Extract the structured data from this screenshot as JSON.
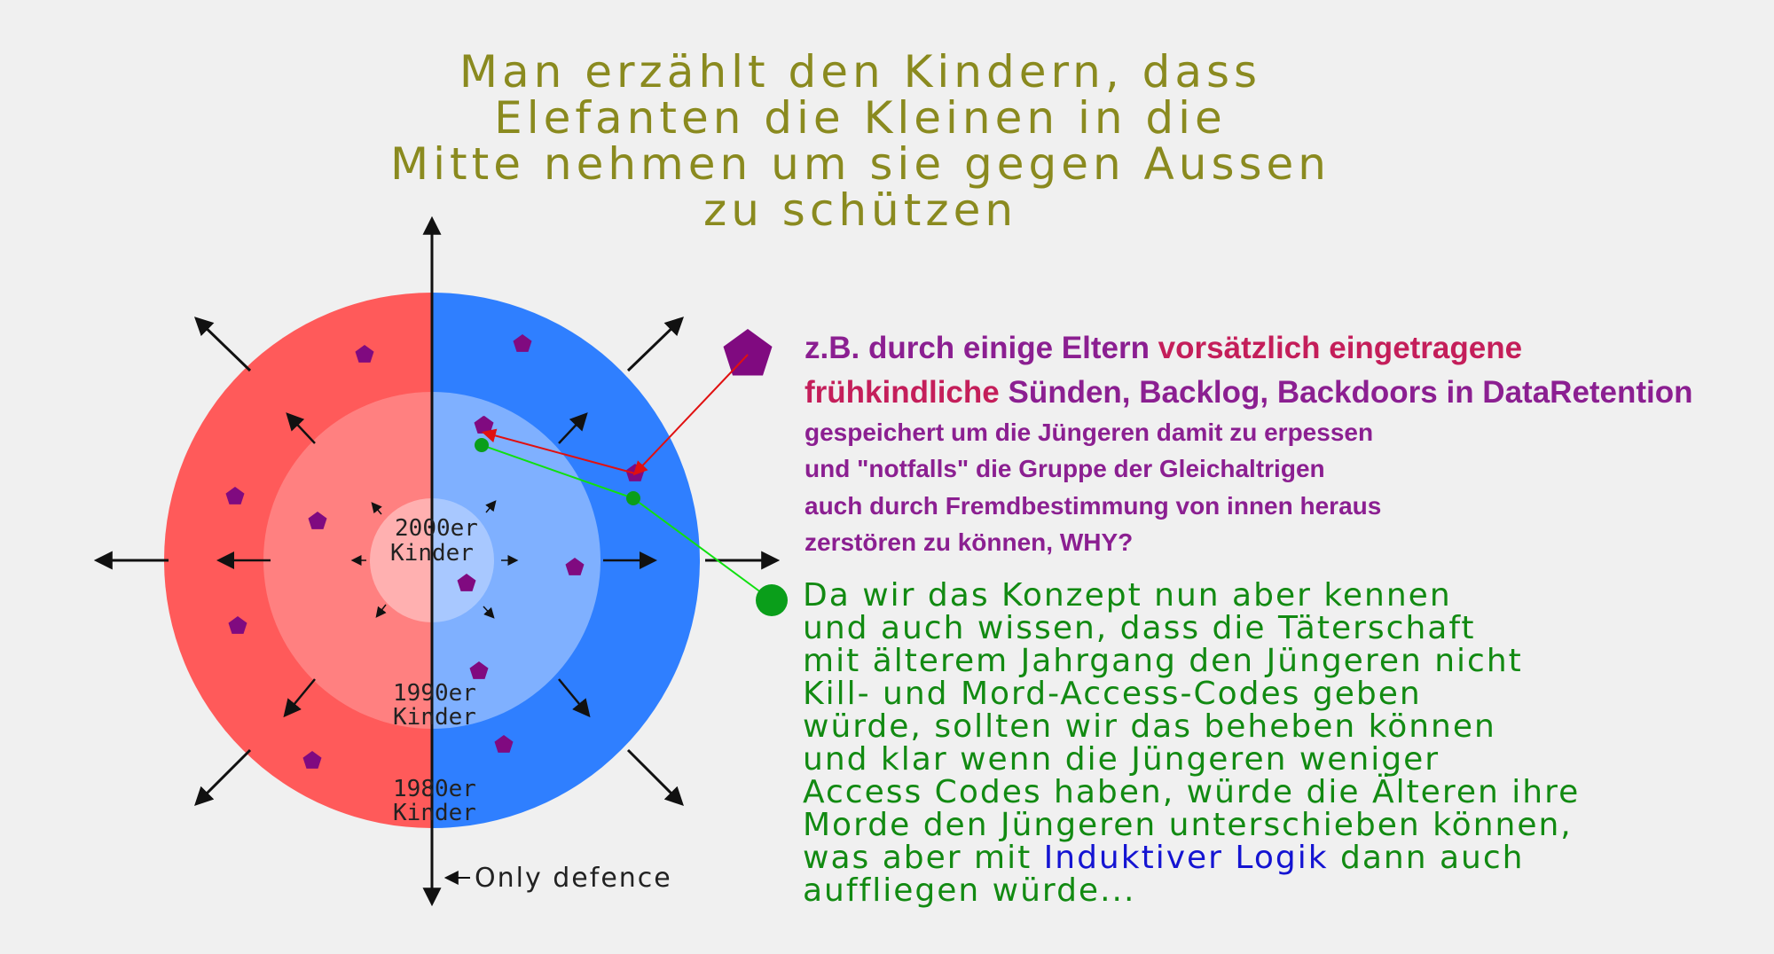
{
  "title": {
    "lines": [
      "Man erzählt den Kindern, dass",
      "Elefanten die Kleinen in die",
      "Mitte nehmen um sie gegen Aussen",
      "zu schützen"
    ]
  },
  "rings": {
    "inner_label": [
      "2000er",
      "Kinder"
    ],
    "middle_label": [
      "1990er",
      "Kinder"
    ],
    "outer_label": [
      "1980er",
      "Kinder"
    ]
  },
  "defence_label": "Only defence",
  "purple_text": {
    "line1_pre": "z.B. durch einige Eltern ",
    "line1_hl": "vorsätzlich eingetragene",
    "line2_hl": "frühkindliche",
    "line2_post": " Sünden, Backlog, Backdoors in DataRetention",
    "line3": "gespeichert um die Jüngeren damit zu erpessen",
    "line4": "und \"notfalls\" die Gruppe der Gleichaltrigen",
    "line5": "auch durch Fremdbestimmung von innen heraus",
    "line6": "zerstören zu können, WHY?"
  },
  "green_text": {
    "line1": "Da wir das Konzept nun aber kennen",
    "line2": "und auch wissen, dass die Täterschaft",
    "line3": "mit älterem Jahrgang den Jüngeren nicht",
    "line4": "Kill- und Mord-Access-Codes geben",
    "line5": "würde, sollten wir das beheben können",
    "line6": "und klar wenn die Jüngeren weniger",
    "line7": "Access Codes haben, würde die Älteren ihre",
    "line8": "Morde den Jüngeren unterschieben können,",
    "line9_pre": "was aber mit ",
    "line9_hl": "Induktiver Logik",
    "line9_post": " dann auch",
    "line10": "auffliegen würde..."
  },
  "colors": {
    "left_outer": "#ff5a5a",
    "left_middle": "#ff8080",
    "left_inner": "#ffb0b0",
    "right_outer": "#2f7fff",
    "right_middle": "#7fb0ff",
    "right_inner": "#a8c8ff",
    "pentagon": "#800a80",
    "title": "#8a8a1f",
    "purple_text": "#8b1f91",
    "highlight": "#c41e5a",
    "green_text": "#128a12",
    "link_blue": "#1414d2",
    "red_line": "#e01010",
    "green_line": "#10e010"
  }
}
